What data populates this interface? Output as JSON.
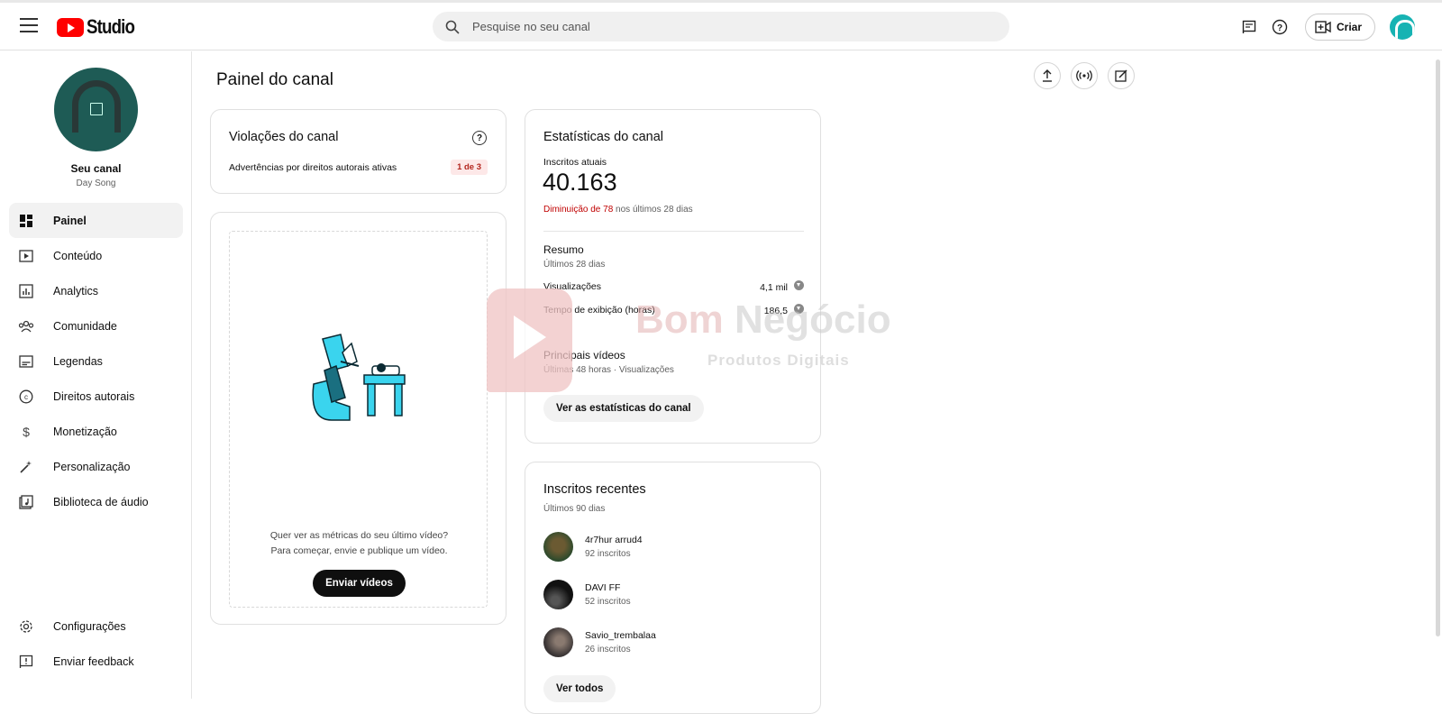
{
  "header": {
    "logo_text": "Studio",
    "search_placeholder": "Pesquise no seu canal",
    "create_label": "Criar"
  },
  "sidebar": {
    "channel_name": "Seu canal",
    "channel_handle": "Day Song",
    "items": [
      {
        "label": "Painel",
        "icon": "dashboard-icon"
      },
      {
        "label": "Conteúdo",
        "icon": "content-icon"
      },
      {
        "label": "Analytics",
        "icon": "analytics-icon"
      },
      {
        "label": "Comunidade",
        "icon": "community-icon"
      },
      {
        "label": "Legendas",
        "icon": "subtitles-icon"
      },
      {
        "label": "Direitos autorais",
        "icon": "copyright-icon"
      },
      {
        "label": "Monetização",
        "icon": "monetization-icon"
      },
      {
        "label": "Personalização",
        "icon": "customization-icon"
      },
      {
        "label": "Biblioteca de áudio",
        "icon": "audio-library-icon"
      }
    ],
    "settings_label": "Configurações",
    "feedback_label": "Enviar feedback"
  },
  "main": {
    "title": "Painel do canal"
  },
  "violations": {
    "title": "Violações do canal",
    "label": "Advertências por direitos autorais ativas",
    "badge": "1 de 3"
  },
  "upload_card": {
    "line1": "Quer ver as métricas do seu último vídeo?",
    "line2": "Para começar, envie e publique um vídeo.",
    "button": "Enviar vídeos"
  },
  "stats": {
    "title": "Estatísticas do canal",
    "subscribers_label": "Inscritos atuais",
    "subscribers_value": "40.163",
    "change_red": "Diminuição de 78",
    "change_rest": " nos últimos 28 dias",
    "summary_title": "Resumo",
    "summary_period": "Últimos 28 dias",
    "views_label": "Visualizações",
    "views_value": "4,1 mil",
    "watch_label": "Tempo de exibição (horas)",
    "watch_value": "186,5",
    "top_title": "Principais vídeos",
    "top_period": "Últimas 48 horas · Visualizações",
    "button": "Ver as estatísticas do canal"
  },
  "recent_subs": {
    "title": "Inscritos recentes",
    "period": "Últimos 90 dias",
    "items": [
      {
        "name": "4r7hur arrud4",
        "count": "92 inscritos"
      },
      {
        "name": "DAVI FF",
        "count": "52 inscritos"
      },
      {
        "name": "Savio_trembalaa",
        "count": "26 inscritos"
      }
    ],
    "button": "Ver todos"
  },
  "watermark": {
    "brand_a": "Bom ",
    "brand_b": "Negócio",
    "sub": "Produtos Digitais"
  },
  "colors": {
    "accent_red": "#ff0000",
    "decrease_red": "#c00000",
    "illustration_cyan": "#3ad4ee"
  }
}
